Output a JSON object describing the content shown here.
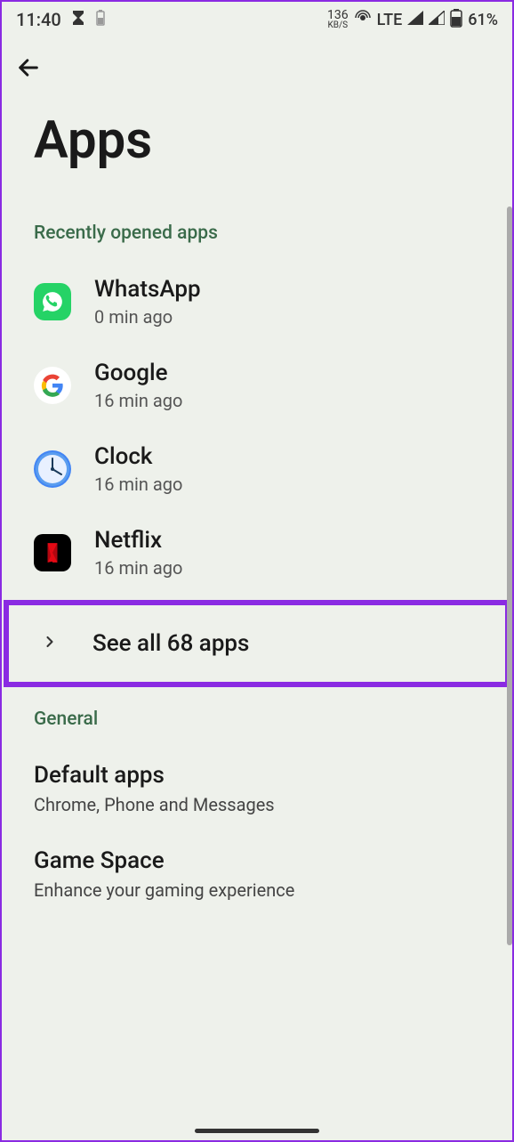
{
  "status_bar": {
    "time": "11:40",
    "data_rate": "136",
    "data_unit": "KB/S",
    "network": "LTE",
    "battery": "61%"
  },
  "page": {
    "title": "Apps"
  },
  "sections": {
    "recent_header": "Recently opened apps",
    "general_header": "General"
  },
  "recent_apps": [
    {
      "name": "WhatsApp",
      "time": "0 min ago"
    },
    {
      "name": "Google",
      "time": "16 min ago"
    },
    {
      "name": "Clock",
      "time": "16 min ago"
    },
    {
      "name": "Netflix",
      "time": "16 min ago"
    }
  ],
  "see_all": {
    "label": "See all 68 apps"
  },
  "general_settings": [
    {
      "title": "Default apps",
      "subtitle": "Chrome, Phone and Messages"
    },
    {
      "title": "Game Space",
      "subtitle": "Enhance your gaming experience"
    }
  ]
}
